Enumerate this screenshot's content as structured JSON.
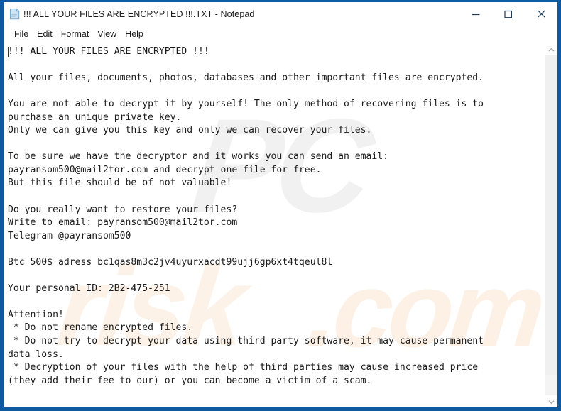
{
  "window": {
    "title": "!!! ALL YOUR FILES ARE ENCRYPTED !!!.TXT - Notepad",
    "app_icon": "notepad-document-icon",
    "border_color": "#0f5a9e",
    "controls": [
      {
        "name": "minimize",
        "glyph": "minimize-icon",
        "label": "Minimize"
      },
      {
        "name": "maximize",
        "glyph": "maximize-icon",
        "label": "Maximize"
      },
      {
        "name": "close",
        "glyph": "close-icon",
        "label": "Close"
      }
    ]
  },
  "menubar": {
    "items": [
      {
        "label": "File"
      },
      {
        "label": "Edit"
      },
      {
        "label": "Format"
      },
      {
        "label": "View"
      },
      {
        "label": "Help"
      }
    ]
  },
  "editor": {
    "caret_visible": true,
    "font": "monospace",
    "text_color": "#1b1b1b",
    "background_color": "#ffffff",
    "content": "!!! ALL YOUR FILES ARE ENCRYPTED !!!\n\nAll your files, documents, photos, databases and other important files are encrypted.\n\nYou are not able to decrypt it by yourself! The only method of recovering files is to\npurchase an unique private key.\nOnly we can give you this key and only we can recover your files.\n\nTo be sure we have the decryptor and it works you can send an email:\npayransom500@mail2tor.com and decrypt one file for free.\nBut this file should be of not valuable!\n\nDo you really want to restore your files?\nWrite to email: payransom500@mail2tor.com\nTelegram @payransom500\n\nBtc 500$ adress bc1qas8m3c2jv4uyurxacdt99ujj6gp6xt4tqeul8l\n\nYour personal ID: 2B2-475-251\n\nAttention!\n * Do not rename encrypted files.\n * Do not try to decrypt your data using third party software, it may cause permanent\ndata loss.\n * Decryption of your files with the help of third parties may cause increased price\n(they add their fee to our) or you can become a victim of a scam.",
    "ransom_details": {
      "headline": "!!! ALL YOUR FILES ARE ENCRYPTED !!!",
      "contact_email": "payransom500@mail2tor.com",
      "telegram": "@payransom500",
      "ransom_amount": "500$",
      "ransom_currency": "Btc",
      "btc_address": "bc1qas8m3c2jv4uyurxacdt99ujj6gp6xt4tqeul8l",
      "personal_id": "2B2-475-251"
    }
  },
  "scrollbar": {
    "up_arrow": "chevron-up-icon",
    "down_arrow": "chevron-down-icon",
    "thumb_visible": true
  },
  "watermark": {
    "part1": "PC",
    "part2": "risk",
    "part3": ".com"
  }
}
